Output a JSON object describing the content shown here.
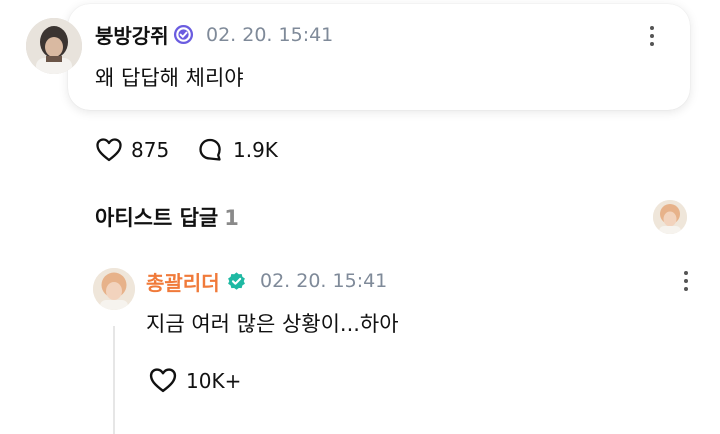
{
  "post": {
    "username": "붕방강쥐",
    "timestamp": "02. 20. 15:41",
    "text": "왜 답답해 체리야",
    "likes": "875",
    "comments": "1.9K",
    "verify_color": "#6a5ce0"
  },
  "artist_section": {
    "title": "아티스트 답글",
    "count": "1"
  },
  "artist_reply": {
    "username": "총괄리더",
    "timestamp": "02. 20. 15:41",
    "text": "지금 여러 많은 상황이...하아",
    "likes": "10K+",
    "name_color": "#f07a3a",
    "verify_color": "#1fb9a3"
  },
  "icons": {
    "more": "more-vertical-icon",
    "like": "heart-outline-icon",
    "comment": "speech-bubble-icon",
    "verified": "verified-badge-icon"
  }
}
